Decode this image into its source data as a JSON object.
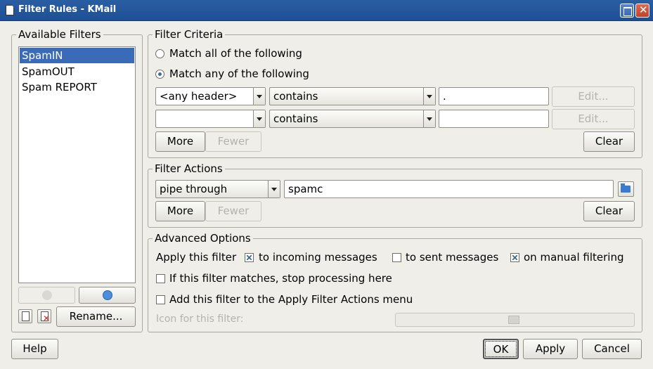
{
  "window": {
    "title": "Filter Rules - KMail"
  },
  "available_filters": {
    "legend": "Available Filters",
    "items": [
      "SpamIN",
      "SpamOUT",
      "Spam REPORT"
    ],
    "selected_index": 0,
    "rename_label": "Rename..."
  },
  "criteria": {
    "legend": "Filter Criteria",
    "match_all_label": "Match all of the following",
    "match_any_label": "Match any of the following",
    "selected_mode": "any",
    "rules": [
      {
        "field": "<any header>",
        "op": "contains",
        "value": ".",
        "edit_label": "Edit..."
      },
      {
        "field": "",
        "op": "contains",
        "value": "",
        "edit_label": "Edit..."
      }
    ],
    "more_label": "More",
    "fewer_label": "Fewer",
    "clear_label": "Clear"
  },
  "actions": {
    "legend": "Filter Actions",
    "action": "pipe through",
    "value": "spamc",
    "more_label": "More",
    "fewer_label": "Fewer",
    "clear_label": "Clear"
  },
  "advanced": {
    "legend": "Advanced Options",
    "apply_label": "Apply this filter",
    "incoming_label": "to incoming messages",
    "incoming_checked": true,
    "sent_label": "to sent messages",
    "sent_checked": false,
    "manual_label": "on manual filtering",
    "manual_checked": true,
    "stop_label": "If this filter matches, stop processing here",
    "stop_checked": false,
    "menu_label": "Add this filter to the Apply Filter Actions menu",
    "menu_checked": false,
    "icon_label": "Icon for this filter:"
  },
  "footer": {
    "help_label": "Help",
    "ok_label": "OK",
    "apply_label": "Apply",
    "cancel_label": "Cancel"
  },
  "colors": {
    "titlebar": "#1e4f94",
    "selection": "#3a6bb8",
    "dialog_bg": "#efeee9"
  }
}
